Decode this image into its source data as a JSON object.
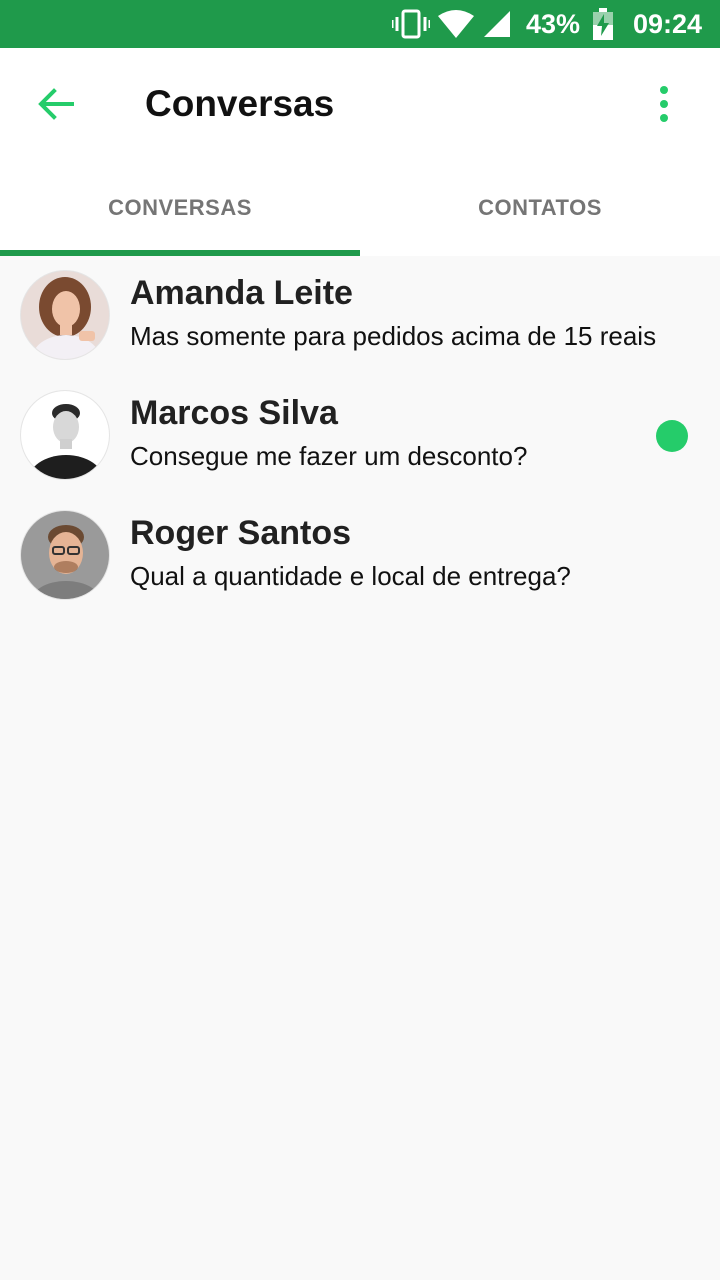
{
  "status_bar": {
    "battery_percent": "43%",
    "time": "09:24",
    "icons": [
      "vibrate-icon",
      "wifi-icon",
      "signal-icon",
      "battery-charging-icon"
    ]
  },
  "app_bar": {
    "title": "Conversas",
    "back_icon": "arrow-back-icon",
    "menu_icon": "more-vert-icon",
    "accent_color": "#25cc6a"
  },
  "tabs": [
    {
      "label": "CONVERSAS",
      "selected": true
    },
    {
      "label": "CONTATOS",
      "selected": false
    }
  ],
  "conversations": [
    {
      "name": "Amanda Leite",
      "message": "Mas somente para pedidos acima de 15 reais",
      "unread": false
    },
    {
      "name": "Marcos Silva",
      "message": "Consegue me fazer um desconto?",
      "unread": true
    },
    {
      "name": "Roger Santos",
      "message": "Qual a quantidade e local de entrega?",
      "unread": false
    }
  ],
  "colors": {
    "primary": "#1f9a4b",
    "unread_dot": "#25cc6a",
    "background": "#f9f9f9"
  }
}
